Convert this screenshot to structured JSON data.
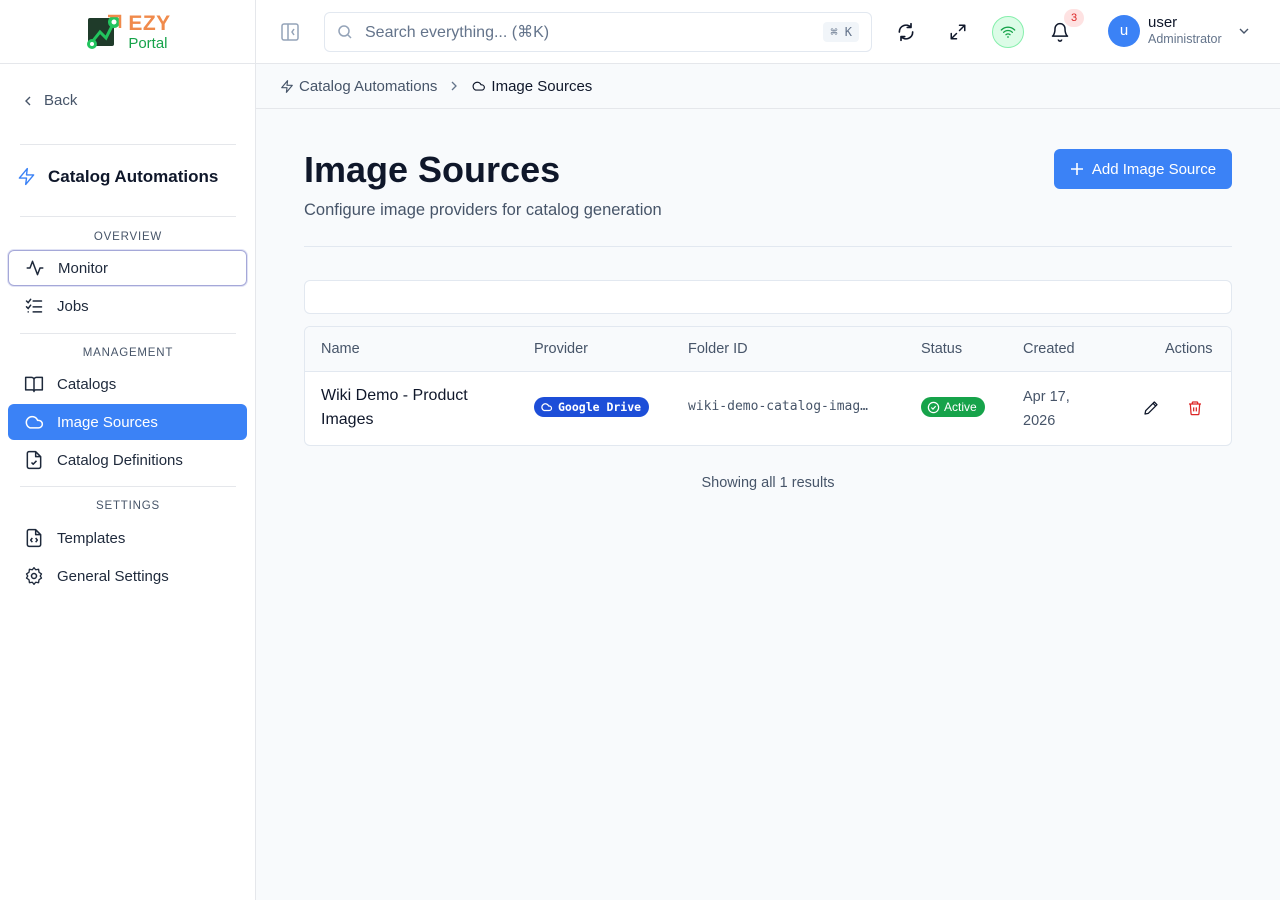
{
  "brand": {
    "line1": "EZY",
    "line2": "Portal"
  },
  "sidebar": {
    "back_label": "Back",
    "module_title": "Catalog Automations",
    "sections": [
      {
        "label": "OVERVIEW",
        "items": [
          {
            "label": "Monitor",
            "icon": "activity-icon"
          },
          {
            "label": "Jobs",
            "icon": "list-checks-icon"
          }
        ]
      },
      {
        "label": "MANAGEMENT",
        "items": [
          {
            "label": "Catalogs",
            "icon": "book-open-icon"
          },
          {
            "label": "Image Sources",
            "icon": "cloud-icon",
            "active": true
          },
          {
            "label": "Catalog Definitions",
            "icon": "file-check-icon"
          }
        ]
      },
      {
        "label": "SETTINGS",
        "items": [
          {
            "label": "Templates",
            "icon": "file-code-icon"
          },
          {
            "label": "General Settings",
            "icon": "gear-icon"
          }
        ]
      }
    ]
  },
  "header": {
    "search_placeholder": "Search everything... (⌘K)",
    "search_shortcut": "⌘ K",
    "notification_count": "3",
    "user": {
      "initial": "u",
      "name": "user",
      "role": "Administrator"
    }
  },
  "breadcrumb": [
    {
      "label": "Catalog Automations"
    },
    {
      "label": "Image Sources"
    }
  ],
  "main": {
    "title": "Image Sources",
    "subtitle": "Configure image providers for catalog generation",
    "add_button_label": "Add Image Source",
    "table": {
      "columns": [
        "Name",
        "Provider",
        "Folder ID",
        "Status",
        "Created",
        "Actions"
      ],
      "rows": [
        {
          "name": "Wiki Demo - Product Images",
          "provider": "Google Drive",
          "folder_id": "wiki-demo-catalog-imag…",
          "status": "Active",
          "created": "Apr 17, 2026"
        }
      ]
    },
    "results_text": "Showing all 1 results"
  },
  "colors": {
    "accent": "#3b82f6",
    "provider_badge": "#1d4ed8",
    "status_active": "#16a34a",
    "danger": "#dc2626"
  }
}
